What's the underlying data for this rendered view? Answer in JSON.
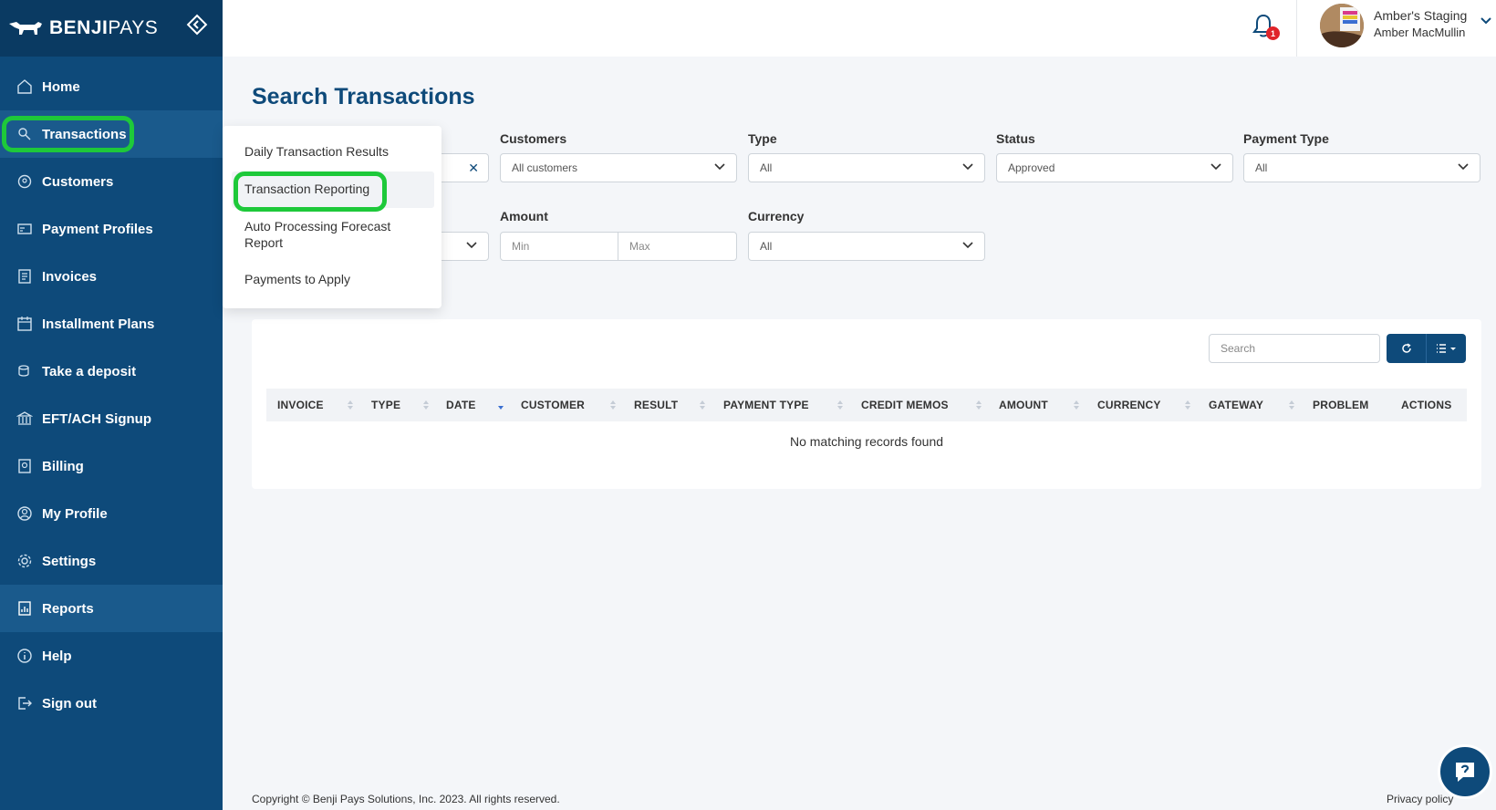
{
  "brand": {
    "name_bold": "BENJI",
    "name_light": "PAYS"
  },
  "sidebar": {
    "items": [
      {
        "label": "Home",
        "icon": "home-icon"
      },
      {
        "label": "Transactions",
        "icon": "transactions-icon"
      },
      {
        "label": "Customers",
        "icon": "customers-icon"
      },
      {
        "label": "Payment Profiles",
        "icon": "payment-profiles-icon"
      },
      {
        "label": "Invoices",
        "icon": "invoices-icon"
      },
      {
        "label": "Installment Plans",
        "icon": "calendar-icon"
      },
      {
        "label": "Take a deposit",
        "icon": "deposit-icon"
      },
      {
        "label": "EFT/ACH Signup",
        "icon": "bank-icon"
      },
      {
        "label": "Billing",
        "icon": "billing-icon"
      },
      {
        "label": "My Profile",
        "icon": "profile-icon"
      },
      {
        "label": "Settings",
        "icon": "gear-icon"
      },
      {
        "label": "Reports",
        "icon": "reports-icon"
      },
      {
        "label": "Help",
        "icon": "info-icon"
      },
      {
        "label": "Sign out",
        "icon": "sign-out-icon"
      }
    ]
  },
  "header": {
    "notification_count": "1",
    "org_name": "Amber's Staging",
    "user_name": "Amber MacMullin"
  },
  "submenu": {
    "items": [
      "Daily Transaction Results",
      "Transaction Reporting",
      "Auto Processing Forecast",
      "Report",
      "Payments to Apply"
    ]
  },
  "page": {
    "title": "Search Transactions"
  },
  "filters": {
    "customers": {
      "label": "Customers",
      "value": "All customers"
    },
    "type": {
      "label": "Type",
      "value": "All"
    },
    "status": {
      "label": "Status",
      "value": "Approved"
    },
    "payment_type": {
      "label": "Payment Type",
      "value": "All"
    },
    "amount": {
      "label": "Amount",
      "min_placeholder": "Min",
      "max_placeholder": "Max"
    },
    "currency": {
      "label": "Currency",
      "value": "All"
    }
  },
  "table": {
    "search_placeholder": "Search",
    "columns": [
      "INVOICE",
      "TYPE",
      "DATE",
      "CUSTOMER",
      "RESULT",
      "PAYMENT TYPE",
      "CREDIT MEMOS",
      "AMOUNT",
      "CURRENCY",
      "GATEWAY",
      "PROBLEM",
      "ACTIONS"
    ],
    "empty_message": "No matching records found"
  },
  "footer": {
    "copyright": "Copyright © Benji Pays Solutions, Inc. 2023. All rights reserved.",
    "privacy": "Privacy policy"
  },
  "colors": {
    "sidebar": "#0e4a7a",
    "accent": "#0e4a7a",
    "highlight": "#1ec93a",
    "badge": "#e0242a"
  }
}
